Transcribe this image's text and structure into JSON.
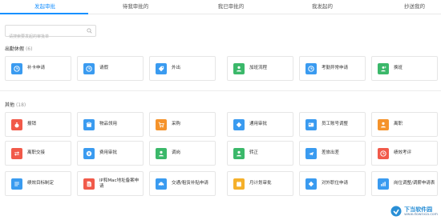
{
  "tabs": [
    {
      "label": "发起审批",
      "active": true
    },
    {
      "label": "待我审批的",
      "active": false
    },
    {
      "label": "我已审批的",
      "active": false
    },
    {
      "label": "我发起的",
      "active": false
    },
    {
      "label": "抄送我的",
      "active": false
    }
  ],
  "search": {
    "placeholder": "请搜索要发起的审批单"
  },
  "sections": [
    {
      "title": "出勤休假",
      "count": "(6)",
      "items": [
        {
          "label": "补卡申请",
          "icon": "clock-icon",
          "color": "#3a9bf0"
        },
        {
          "label": "请假",
          "icon": "clock-icon",
          "color": "#3a9bf0"
        },
        {
          "label": "外出",
          "icon": "tag-icon",
          "color": "#3a9bf0"
        },
        {
          "label": "加班流程",
          "icon": "person-icon",
          "color": "#3bb86a"
        },
        {
          "label": "考勤异常申请",
          "icon": "clock-icon",
          "color": "#3a9bf0"
        },
        {
          "label": "换班",
          "icon": "person-swap-icon",
          "color": "#3bb86a"
        }
      ]
    },
    {
      "title": "其他",
      "count": "(18)",
      "items": [
        {
          "label": "报销",
          "icon": "money-bag-icon",
          "color": "#f15a4a"
        },
        {
          "label": "物品领用",
          "icon": "box-icon",
          "color": "#3a9bf0"
        },
        {
          "label": "采购",
          "icon": "cart-icon",
          "color": "#f5932b"
        },
        {
          "label": "通用审批",
          "icon": "diamond-icon",
          "color": "#3a9bf0"
        },
        {
          "label": "员工账号调整",
          "icon": "card-icon",
          "color": "#3a9bf0"
        },
        {
          "label": "离职",
          "icon": "person-icon",
          "color": "#f5932b"
        },
        {
          "label": "离职交接",
          "icon": "swap-icon",
          "color": "#f15a4a"
        },
        {
          "label": "费用审批",
          "icon": "money-icon",
          "color": "#3a9bf0"
        },
        {
          "label": "调岗",
          "icon": "person-icon",
          "color": "#3bb86a"
        },
        {
          "label": "转正",
          "icon": "person-icon",
          "color": "#3bb86a"
        },
        {
          "label": "差旅出差",
          "icon": "plane-icon",
          "color": "#3a9bf0"
        },
        {
          "label": "绩效考评",
          "icon": "clock-icon",
          "color": "#f15a4a"
        },
        {
          "label": "绩效目标制定",
          "icon": "list-icon",
          "color": "#3a9bf0"
        },
        {
          "label": "IP和Mac地址备案申请",
          "icon": "document-icon",
          "color": "#f15a4a"
        },
        {
          "label": "交通/租赁补贴申请",
          "icon": "car-icon",
          "color": "#3a9bf0"
        },
        {
          "label": "月计划审批",
          "icon": "calendar-icon",
          "color": "#f5b02b"
        },
        {
          "label": "对外职位申请",
          "icon": "diamond-icon",
          "color": "#3a9bf0"
        },
        {
          "label": "岗位调整/调薪申请表",
          "icon": "chart-icon",
          "color": "#3a9bf0"
        }
      ]
    }
  ],
  "watermark": {
    "title": "下当软件园",
    "subtitle": "www.downxia.com"
  }
}
